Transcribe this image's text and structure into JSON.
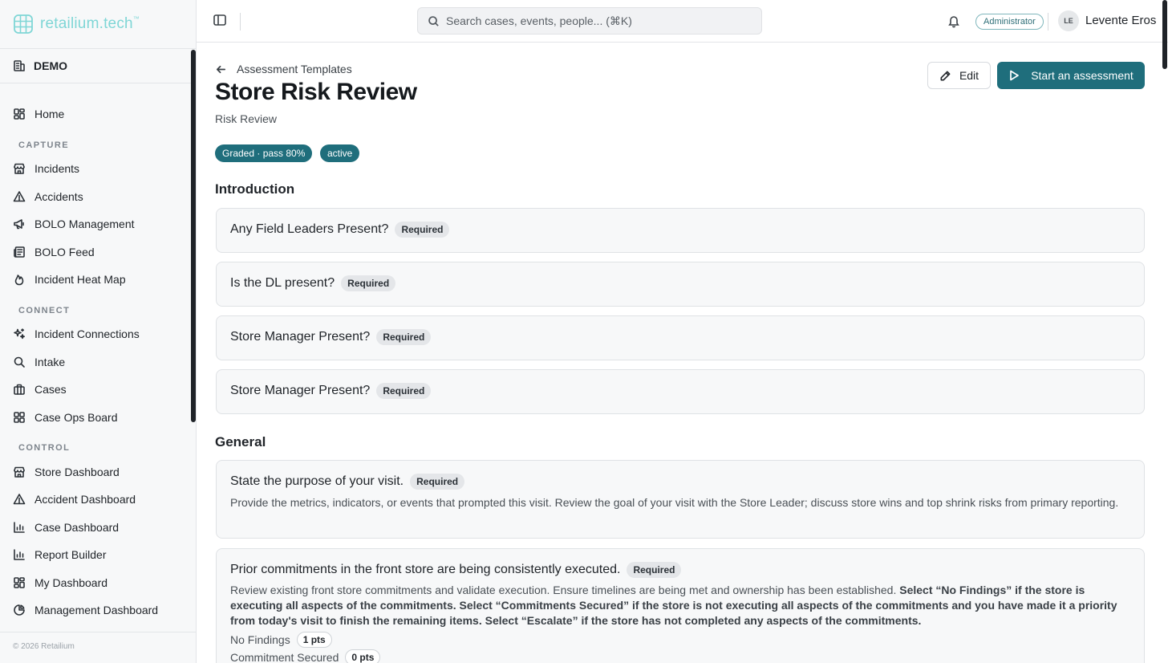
{
  "brand": {
    "name": "retailium.tech",
    "mark": "™"
  },
  "sidebar": {
    "tenant": "DEMO",
    "home": "Home",
    "sections": {
      "capture": "CAPTURE",
      "connect": "CONNECT",
      "control": "CONTROL"
    },
    "items": {
      "incidents": "Incidents",
      "accidents": "Accidents",
      "bolo_management": "BOLO Management",
      "bolo_feed": "BOLO Feed",
      "heat_map": "Incident Heat Map",
      "incident_connections": "Incident Connections",
      "intake": "Intake",
      "cases": "Cases",
      "case_ops": "Case Ops Board",
      "store_dashboard": "Store Dashboard",
      "accident_dashboard": "Accident Dashboard",
      "case_dashboard": "Case Dashboard",
      "report_builder": "Report Builder",
      "my_dashboard": "My Dashboard",
      "management_dashboard": "Management Dashboard"
    },
    "copyright": "© 2026 Retailium"
  },
  "topbar": {
    "search_placeholder": "Search cases, events, people... (⌘K)",
    "role": "Administrator",
    "avatar_initials": "LE",
    "user_name": "Levente Eros"
  },
  "page": {
    "back_label": "Assessment Templates",
    "title": "Store Risk Review",
    "subtitle": "Risk Review",
    "edit_label": "Edit",
    "start_label": "Start an assessment",
    "badge_grading": "Graded · pass 80%",
    "badge_status": "active"
  },
  "sections": {
    "intro": {
      "title": "Introduction",
      "questions": [
        {
          "text": "Any Field Leaders Present?",
          "tag": "Required"
        },
        {
          "text": "Is the DL present?",
          "tag": "Required"
        },
        {
          "text": "Store Manager Present?",
          "tag": "Required"
        },
        {
          "text": "Store Manager Present?",
          "tag": "Required"
        }
      ]
    },
    "general": {
      "title": "General",
      "questions": [
        {
          "text": "State the purpose of your visit.",
          "tag": "Required",
          "description": "Provide the metrics, indicators, or events that prompted this visit. Review the goal of your visit with the Store Leader; discuss store wins and top shrink risks from primary reporting."
        },
        {
          "text": "Prior commitments in the front store are being consistently executed.",
          "tag": "Required",
          "description_plain": "Review existing front store commitments and validate execution. Ensure timelines are being met and ownership has been established. ",
          "description_bold": "Select “No Findings” if the store is executing all aspects of the commitments. Select “Commitments Secured” if the store is not executing all aspects of the commitments and you have made it a priority from today's visit to finish the remaining items. Select “Escalate” if the store has not completed any aspects of the commitments.",
          "options": [
            {
              "label": "No Findings",
              "points": "1 pts"
            },
            {
              "label": "Commitment Secured",
              "points": "0 pts"
            }
          ]
        }
      ]
    }
  },
  "colors": {
    "primary": "#1f6e7c",
    "brand_teal": "#7fd6d6",
    "card_bg": "#f7f8f9",
    "sidebar_bg": "#f7f8f9"
  }
}
